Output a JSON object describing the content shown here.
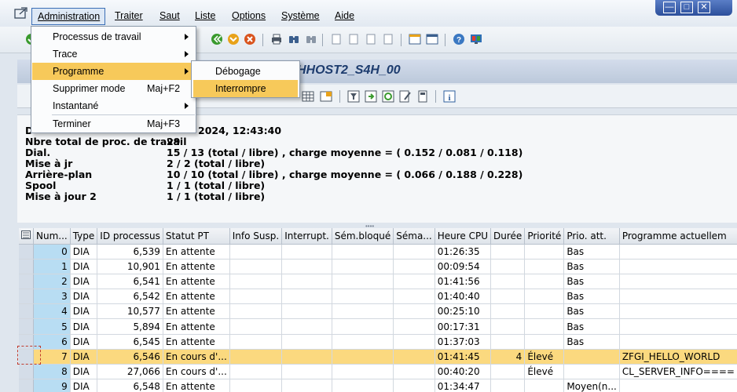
{
  "menubar": {
    "items": [
      {
        "label": "Administration"
      },
      {
        "label": "Traiter"
      },
      {
        "label": "Saut"
      },
      {
        "label": "Liste"
      },
      {
        "label": "Options"
      },
      {
        "label": "Système"
      },
      {
        "label": "Aide"
      }
    ]
  },
  "window_controls": {
    "minimize": "—",
    "maximize": "□",
    "close": "✕"
  },
  "title": "HHOST2_S4H_00",
  "dropdown": {
    "items": [
      {
        "label": "Processus de travail",
        "shortcut": "",
        "has_submenu": true
      },
      {
        "label": "Trace",
        "shortcut": "",
        "has_submenu": true
      },
      {
        "label": "Programme",
        "shortcut": "",
        "has_submenu": true
      },
      {
        "label": "Supprimer mode",
        "shortcut": "Maj+F2",
        "has_submenu": false
      },
      {
        "label": "Instantané",
        "shortcut": "",
        "has_submenu": true
      },
      {
        "label": "Terminer",
        "shortcut": "Maj+F3",
        "has_submenu": false
      }
    ],
    "submenu": [
      {
        "label": "Débogage"
      },
      {
        "label": "Interrompre"
      }
    ]
  },
  "info": {
    "date_label": "D",
    "date_value": "2024, 12:43:40",
    "rows": [
      {
        "label": "Nbre total de proc. de travail",
        "value": "29"
      },
      {
        "label": "Dial.",
        "value": "15 / 13 (total / libre) , charge moyenne = ( 0.152 / 0.081 / 0.118)"
      },
      {
        "label": "Mise à jr",
        "value": "2 / 2 (total / libre)"
      },
      {
        "label": "Arrière-plan",
        "value": "10 / 10 (total / libre) , charge moyenne = ( 0.066 / 0.188 / 0.228)"
      },
      {
        "label": "Spool",
        "value": "1 / 1 (total / libre)"
      },
      {
        "label": "Mise à jour 2",
        "value": "1 / 1 (total / libre)"
      }
    ]
  },
  "table": {
    "columns": [
      "Num...",
      "Type",
      "ID processus",
      "Statut PT",
      "Info Susp.",
      "Interrupt.",
      "Sém.bloqué",
      "Séma...",
      "Heure CPU",
      "Durée",
      "Priorité",
      "Prio. att.",
      "Programme actuellem"
    ],
    "rows": [
      {
        "num": "0",
        "type": "DIA",
        "pid": "6,539",
        "status": "En attente",
        "info": "",
        "interrupt": "",
        "sem_bloque": "",
        "sema": "",
        "cpu": "01:26:35",
        "duree": "",
        "priorite": "",
        "prio_att": "Bas",
        "programme": ""
      },
      {
        "num": "1",
        "type": "DIA",
        "pid": "10,901",
        "status": "En attente",
        "info": "",
        "interrupt": "",
        "sem_bloque": "",
        "sema": "",
        "cpu": "00:09:54",
        "duree": "",
        "priorite": "",
        "prio_att": "Bas",
        "programme": ""
      },
      {
        "num": "2",
        "type": "DIA",
        "pid": "6,541",
        "status": "En attente",
        "info": "",
        "interrupt": "",
        "sem_bloque": "",
        "sema": "",
        "cpu": "01:41:56",
        "duree": "",
        "priorite": "",
        "prio_att": "Bas",
        "programme": ""
      },
      {
        "num": "3",
        "type": "DIA",
        "pid": "6,542",
        "status": "En attente",
        "info": "",
        "interrupt": "",
        "sem_bloque": "",
        "sema": "",
        "cpu": "01:40:40",
        "duree": "",
        "priorite": "",
        "prio_att": "Bas",
        "programme": ""
      },
      {
        "num": "4",
        "type": "DIA",
        "pid": "10,577",
        "status": "En attente",
        "info": "",
        "interrupt": "",
        "sem_bloque": "",
        "sema": "",
        "cpu": "00:25:10",
        "duree": "",
        "priorite": "",
        "prio_att": "Bas",
        "programme": ""
      },
      {
        "num": "5",
        "type": "DIA",
        "pid": "5,894",
        "status": "En attente",
        "info": "",
        "interrupt": "",
        "sem_bloque": "",
        "sema": "",
        "cpu": "00:17:31",
        "duree": "",
        "priorite": "",
        "prio_att": "Bas",
        "programme": ""
      },
      {
        "num": "6",
        "type": "DIA",
        "pid": "6,545",
        "status": "En attente",
        "info": "",
        "interrupt": "",
        "sem_bloque": "",
        "sema": "",
        "cpu": "01:37:03",
        "duree": "",
        "priorite": "",
        "prio_att": "Bas",
        "programme": ""
      },
      {
        "num": "7",
        "type": "DIA",
        "pid": "6,546",
        "status": "En cours d'...",
        "info": "",
        "interrupt": "",
        "sem_bloque": "",
        "sema": "",
        "cpu": "01:41:45",
        "duree": "4",
        "priorite": "Élevé",
        "prio_att": "",
        "programme": "ZFGI_HELLO_WORLD",
        "highlight": true
      },
      {
        "num": "8",
        "type": "DIA",
        "pid": "27,066",
        "status": "En cours d'...",
        "info": "",
        "interrupt": "",
        "sem_bloque": "",
        "sema": "",
        "cpu": "00:40:20",
        "duree": "",
        "priorite": "Élevé",
        "prio_att": "",
        "programme": "CL_SERVER_INFO===="
      },
      {
        "num": "9",
        "type": "DIA",
        "pid": "6,548",
        "status": "En attente",
        "info": "",
        "interrupt": "",
        "sem_bloque": "",
        "sema": "",
        "cpu": "01:34:47",
        "duree": "",
        "priorite": "",
        "prio_att": "Moyen(n...",
        "programme": ""
      }
    ]
  },
  "colors": {
    "accent": "#f7c95a",
    "num_cell": "#b8ddf3",
    "highlight_row": "#fbd97f",
    "titlebar_text": "#1d3c6e"
  }
}
